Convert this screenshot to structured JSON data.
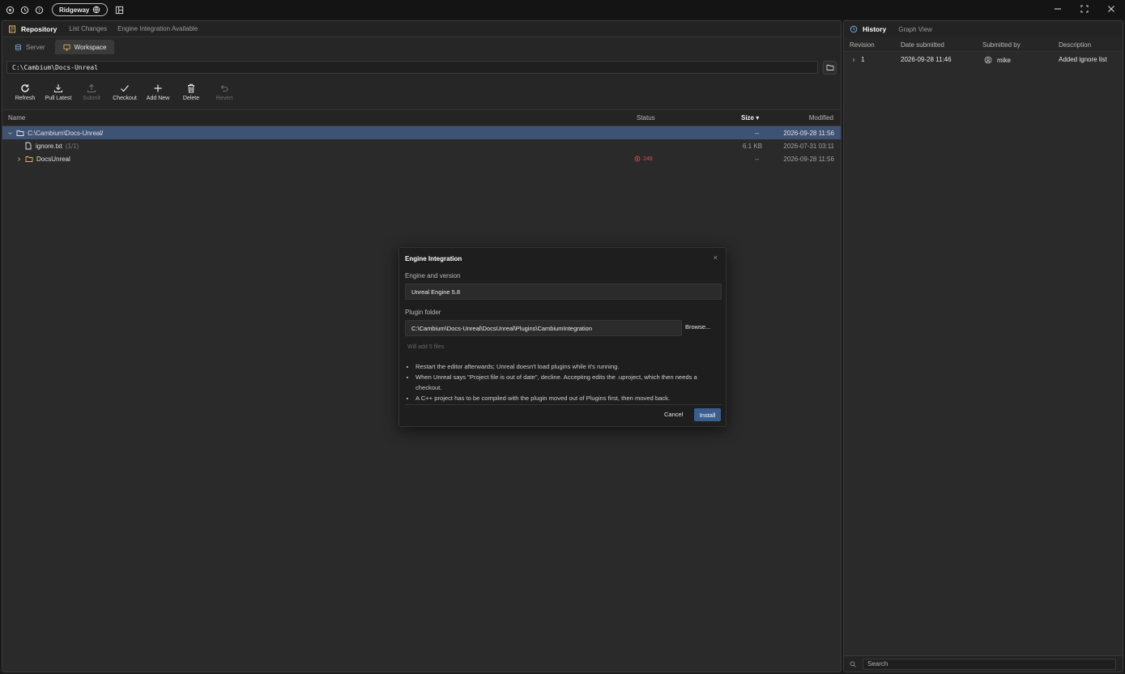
{
  "titlebar": {
    "workspace_name": "Ridgeway"
  },
  "left_panel": {
    "title": "Repository",
    "links": [
      "List Changes",
      "Engine Integration Available"
    ],
    "tabs": [
      {
        "label": "Server"
      },
      {
        "label": "Workspace"
      }
    ],
    "path": "C:\\Cambium\\Docs-Unreal",
    "toolbar": [
      {
        "label": "Refresh",
        "icon": "refresh-icon",
        "enabled": true
      },
      {
        "label": "Pull Latest",
        "icon": "download-icon",
        "enabled": true
      },
      {
        "label": "Submit",
        "icon": "upload-icon",
        "enabled": false
      },
      {
        "label": "Checkout",
        "icon": "check-icon",
        "enabled": true
      },
      {
        "label": "Add New",
        "icon": "plus-icon",
        "enabled": true
      },
      {
        "label": "Delete",
        "icon": "trash-icon",
        "enabled": true
      },
      {
        "label": "Revert",
        "icon": "undo-icon",
        "enabled": false
      }
    ],
    "columns": {
      "name": "Name",
      "status": "Status",
      "size": "Size ▾",
      "modified": "Modified"
    },
    "rows": [
      {
        "name": "C:\\Cambium\\Docs-Unreal/",
        "status": "",
        "size": "--",
        "modified": "2026-09-28 11:56",
        "selected": true
      },
      {
        "name": "ignore.txt",
        "suffix": "(1/1)",
        "status": "",
        "size": "6.1 KB",
        "modified": "2026-07-31 03:11",
        "selected": false
      },
      {
        "name": "DocsUnreal",
        "status": "249",
        "size": "--",
        "modified": "2026-09-28 11:56",
        "selected": false
      }
    ]
  },
  "history": {
    "title": "History",
    "tab2": "Graph View",
    "columns": {
      "revision": "Revision",
      "date": "Date submitted",
      "by": "Submitted by",
      "desc": "Description"
    },
    "rows": [
      {
        "revision": "1",
        "date": "2026-09-28 11:46",
        "by": "mike",
        "desc": "Added ignore list"
      }
    ],
    "search_placeholder": "Search"
  },
  "dialog": {
    "title": "Engine Integration",
    "close": "×",
    "engine_label": "Engine and version",
    "engine_value": "Unreal Engine 5.8",
    "folder_label": "Plugin folder",
    "folder_value": "C:\\Cambium\\Docs-Unreal\\DocsUnreal\\Plugins\\CambiumIntegration",
    "browse": "Browse...",
    "hint": "Will add 5 files.",
    "notes": [
      "Restart the editor afterwards; Unreal doesn't load plugins while it's running.",
      "When Unreal says \"Project file is out of date\", decline. Accepting edits the .uproject, which then needs a checkout.",
      "A C++ project has to be compiled with the plugin moved out of Plugins first, then moved back."
    ],
    "cancel": "Cancel",
    "install": "Install"
  }
}
